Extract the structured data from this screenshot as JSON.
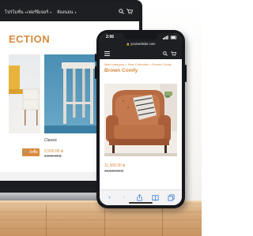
{
  "laptop": {
    "nav_items": [
      "โปรโมชั่น",
      "เฟอร์นิเจอร์",
      "ห้องนอน"
    ],
    "page_title": "ECTION",
    "product_name": "Classic",
    "price": "2,500.00 ฿",
    "old_price": "3,900.00 ฿",
    "cart_button": "สั่งซื้อ"
  },
  "phone": {
    "status_time": "2:06",
    "url": "yourwebsite.com",
    "breadcrumb": "Main category > New Collection > Brown Comfy",
    "product_title": "Brown Comfy",
    "price": "11,500.00 ฿",
    "old_price": "15,500.00 ฿",
    "cart_button": "สั่งซื้อ"
  },
  "colors": {
    "accent": "#d98a3d",
    "dark_bar": "#1e1f22",
    "safari_blue": "#3a7bd5"
  },
  "icons": [
    "search-icon",
    "cart-icon",
    "menu-icon",
    "back-icon",
    "forward-icon",
    "share-icon",
    "bookmarks-icon",
    "tabs-icon"
  ]
}
